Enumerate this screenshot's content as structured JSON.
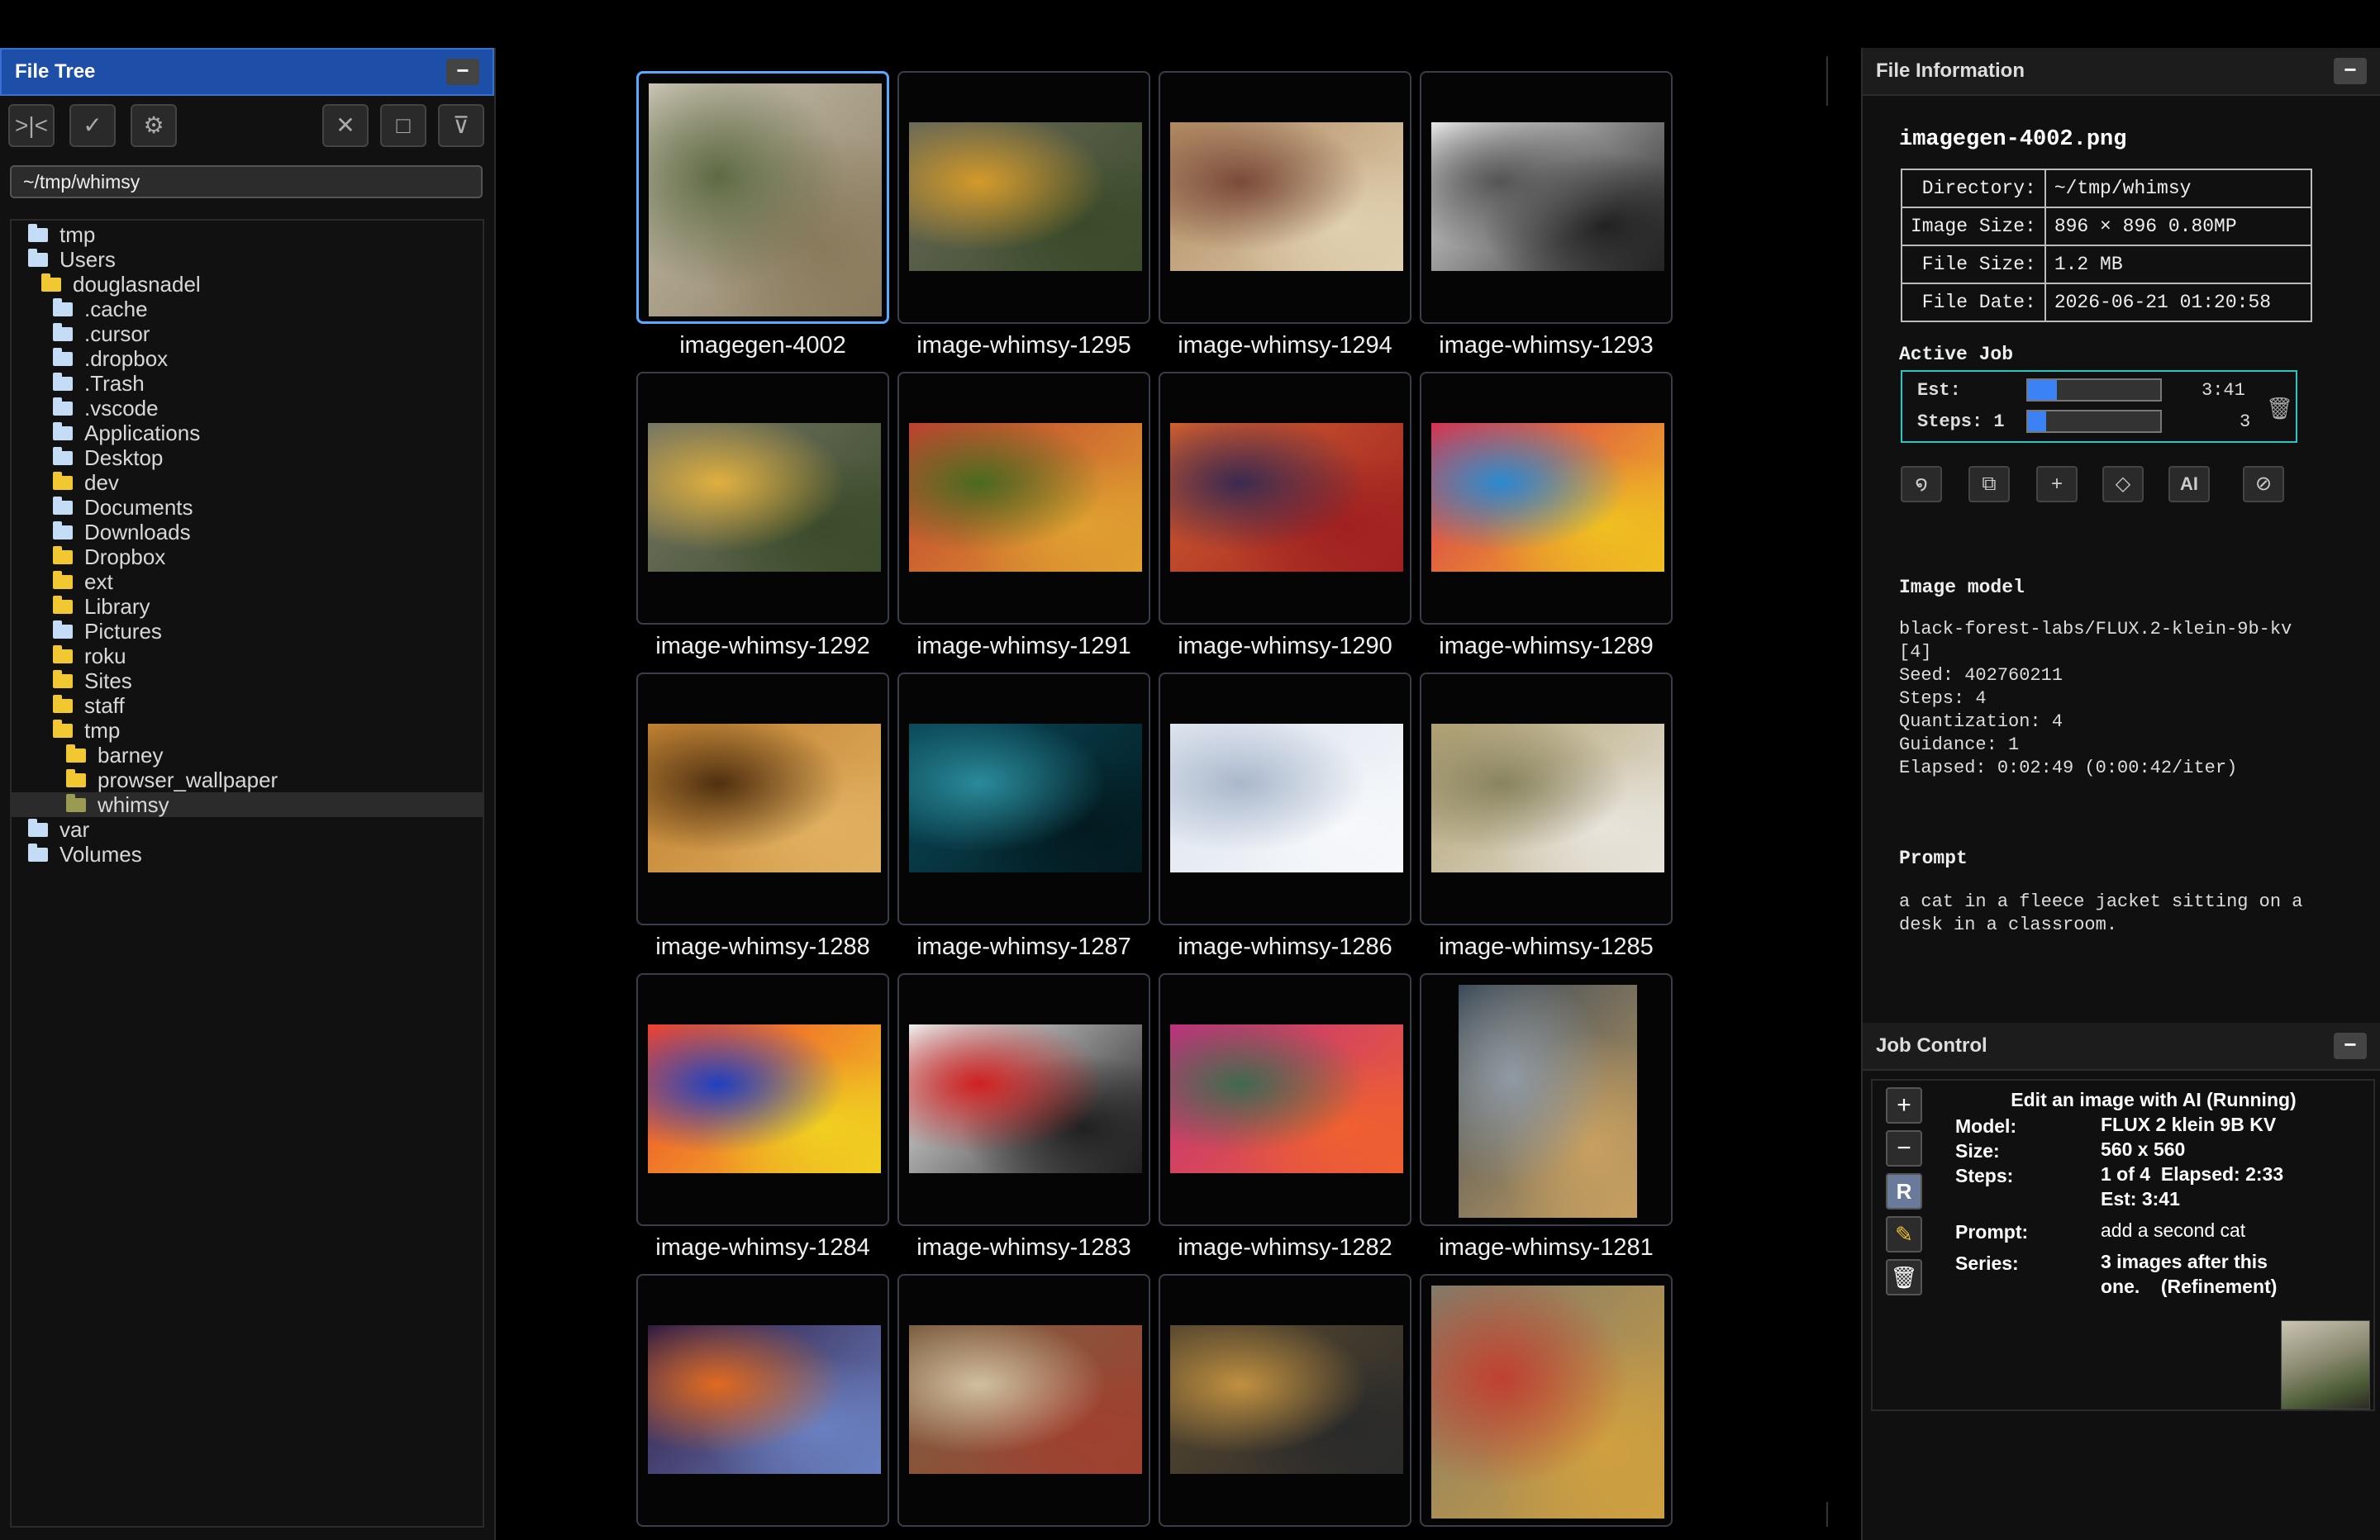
{
  "file_tree": {
    "title": "File Tree",
    "collapse": "−",
    "path": "~/tmp/whimsy",
    "toolbar": [
      "split-icon",
      "check-icon",
      "gear-icon",
      "close-icon",
      "stop-icon",
      "filter-icon"
    ],
    "items": [
      {
        "label": "tmp",
        "indent": 0,
        "color": "blue"
      },
      {
        "label": "Users",
        "indent": 0,
        "color": "blue"
      },
      {
        "label": "douglasnadel",
        "indent": 1,
        "color": "yellow"
      },
      {
        "label": ".cache",
        "indent": 2,
        "color": "blue"
      },
      {
        "label": ".cursor",
        "indent": 2,
        "color": "blue"
      },
      {
        "label": ".dropbox",
        "indent": 2,
        "color": "blue"
      },
      {
        "label": ".Trash",
        "indent": 2,
        "color": "blue"
      },
      {
        "label": ".vscode",
        "indent": 2,
        "color": "blue"
      },
      {
        "label": "Applications",
        "indent": 2,
        "color": "blue"
      },
      {
        "label": "Desktop",
        "indent": 2,
        "color": "blue"
      },
      {
        "label": "dev",
        "indent": 2,
        "color": "yellow"
      },
      {
        "label": "Documents",
        "indent": 2,
        "color": "blue"
      },
      {
        "label": "Downloads",
        "indent": 2,
        "color": "blue"
      },
      {
        "label": "Dropbox",
        "indent": 2,
        "color": "yellow"
      },
      {
        "label": "ext",
        "indent": 2,
        "color": "yellow"
      },
      {
        "label": "Library",
        "indent": 2,
        "color": "yellow"
      },
      {
        "label": "Pictures",
        "indent": 2,
        "color": "blue"
      },
      {
        "label": "roku",
        "indent": 2,
        "color": "yellow"
      },
      {
        "label": "Sites",
        "indent": 2,
        "color": "yellow"
      },
      {
        "label": "staff",
        "indent": 2,
        "color": "yellow"
      },
      {
        "label": "tmp",
        "indent": 2,
        "color": "yellow"
      },
      {
        "label": "barney",
        "indent": 3,
        "color": "yellow"
      },
      {
        "label": "prowser_wallpaper",
        "indent": 3,
        "color": "yellow"
      },
      {
        "label": "whimsy",
        "indent": 3,
        "color": "olive",
        "selected": true
      },
      {
        "label": "var",
        "indent": 0,
        "color": "blue"
      },
      {
        "label": "Volumes",
        "indent": 0,
        "color": "blue"
      }
    ]
  },
  "grid": {
    "tiles": [
      {
        "name": "imagegen-4002",
        "colors": [
          "#c9c4b4",
          "#5e6b44",
          "#8a7a5c"
        ],
        "shape": "full",
        "selected": true
      },
      {
        "name": "image-whimsy-1295",
        "colors": [
          "#6a6a5a",
          "#d49a2a",
          "#3a4a2a"
        ],
        "shape": "wide"
      },
      {
        "name": "image-whimsy-1294",
        "colors": [
          "#b08a60",
          "#7a4a3a",
          "#e0d0b0"
        ],
        "shape": "wide"
      },
      {
        "name": "image-whimsy-1293",
        "colors": [
          "#e8e8e8",
          "#555555",
          "#222222"
        ],
        "shape": "wide"
      },
      {
        "name": "image-whimsy-1292",
        "colors": [
          "#777766",
          "#e0b040",
          "#3b4b2b"
        ],
        "shape": "wide"
      },
      {
        "name": "image-whimsy-1291",
        "colors": [
          "#c04030",
          "#4a6a20",
          "#e0a030"
        ],
        "shape": "wide"
      },
      {
        "name": "image-whimsy-1290",
        "colors": [
          "#d06030",
          "#3a2a50",
          "#a02020"
        ],
        "shape": "wide"
      },
      {
        "name": "image-whimsy-1289",
        "colors": [
          "#d83050",
          "#2a8ad0",
          "#f0c020"
        ],
        "shape": "wide"
      },
      {
        "name": "image-whimsy-1288",
        "colors": [
          "#c08030",
          "#503010",
          "#e0b060"
        ],
        "shape": "wide"
      },
      {
        "name": "image-whimsy-1287",
        "colors": [
          "#0a4a5a",
          "#2a8a9a",
          "#031a20"
        ],
        "shape": "wide"
      },
      {
        "name": "image-whimsy-1286",
        "colors": [
          "#dde4ee",
          "#aab8cc",
          "#f6f8fb"
        ],
        "shape": "wide"
      },
      {
        "name": "image-whimsy-1285",
        "colors": [
          "#b0a070",
          "#8a8460",
          "#e8e4dc"
        ],
        "shape": "wide"
      },
      {
        "name": "image-whimsy-1284",
        "colors": [
          "#f04030",
          "#2040c0",
          "#f0d020"
        ],
        "shape": "wide"
      },
      {
        "name": "image-whimsy-1283",
        "colors": [
          "#f0f0f0",
          "#d02020",
          "#202020"
        ],
        "shape": "wide"
      },
      {
        "name": "image-whimsy-1282",
        "colors": [
          "#c03080",
          "#406a50",
          "#f06030"
        ],
        "shape": "wide"
      },
      {
        "name": "image-whimsy-1281",
        "colors": [
          "#3a4a5a",
          "#909aa4",
          "#c8a060"
        ],
        "shape": "portrait"
      },
      {
        "name": "",
        "colors": [
          "#301a40",
          "#e06a20",
          "#6a80c0"
        ],
        "shape": "wide"
      },
      {
        "name": "",
        "colors": [
          "#7a6040",
          "#d0c0a0",
          "#a04030"
        ],
        "shape": "wide"
      },
      {
        "name": "",
        "colors": [
          "#5a4a30",
          "#c09040",
          "#2a2a2a"
        ],
        "shape": "wide"
      },
      {
        "name": "",
        "colors": [
          "#807a6a",
          "#c04030",
          "#d0a040"
        ],
        "shape": "full"
      }
    ]
  },
  "file_info": {
    "title": "File Information",
    "collapse": "−",
    "filename": "imagegen-4002.png",
    "rows": [
      {
        "key": "Directory:",
        "value": "~/tmp/whimsy"
      },
      {
        "key": "Image Size:",
        "value": "896 × 896 0.80MP"
      },
      {
        "key": "File Size:",
        "value": "1.2 MB"
      },
      {
        "key": "File Date:",
        "value": "2026-06-21 01:20:58"
      }
    ],
    "active_job": {
      "label": "Active Job",
      "est_label": "Est:",
      "est_value": "3:41",
      "est_progress": 0.22,
      "steps_label": "Steps: 1",
      "steps_value": "3",
      "steps_progress": 0.14
    },
    "actions": [
      "swirl-icon",
      "copy-icon",
      "plus",
      "diamond-icon",
      "AI",
      "cancel-icon"
    ],
    "model_label": "Image model",
    "model_lines": [
      "black-forest-labs/FLUX.2-klein-9b-kv",
      "[4]",
      "Seed: 402760211",
      "Steps: 4",
      "Quantization: 4",
      "Guidance: 1",
      "Elapsed: 0:02:49 (0:00:42/iter)"
    ],
    "prompt_label": "Prompt",
    "prompt_lines": [
      "a cat in a fleece jacket sitting on a",
      "desk in a classroom."
    ]
  },
  "job_control": {
    "title": "Job Control",
    "collapse": "−",
    "side_buttons": [
      "+",
      "−",
      "R",
      "pencil",
      "trash"
    ],
    "heading": "Edit an image with AI (Running)",
    "model_label": "Model:",
    "model_value": "FLUX 2 klein 9B KV",
    "size_label": "Size:",
    "size_value": "560 x 560",
    "steps_label": "Steps:",
    "steps_value": "1 of 4  Elapsed: 2:33",
    "est_value": "Est: 3:41",
    "prompt_label": "Prompt:",
    "prompt_value": "add a second cat",
    "series_label": "Series:",
    "series_value_1": "3 images after this",
    "series_value_2": "one.    (Refinement)"
  }
}
